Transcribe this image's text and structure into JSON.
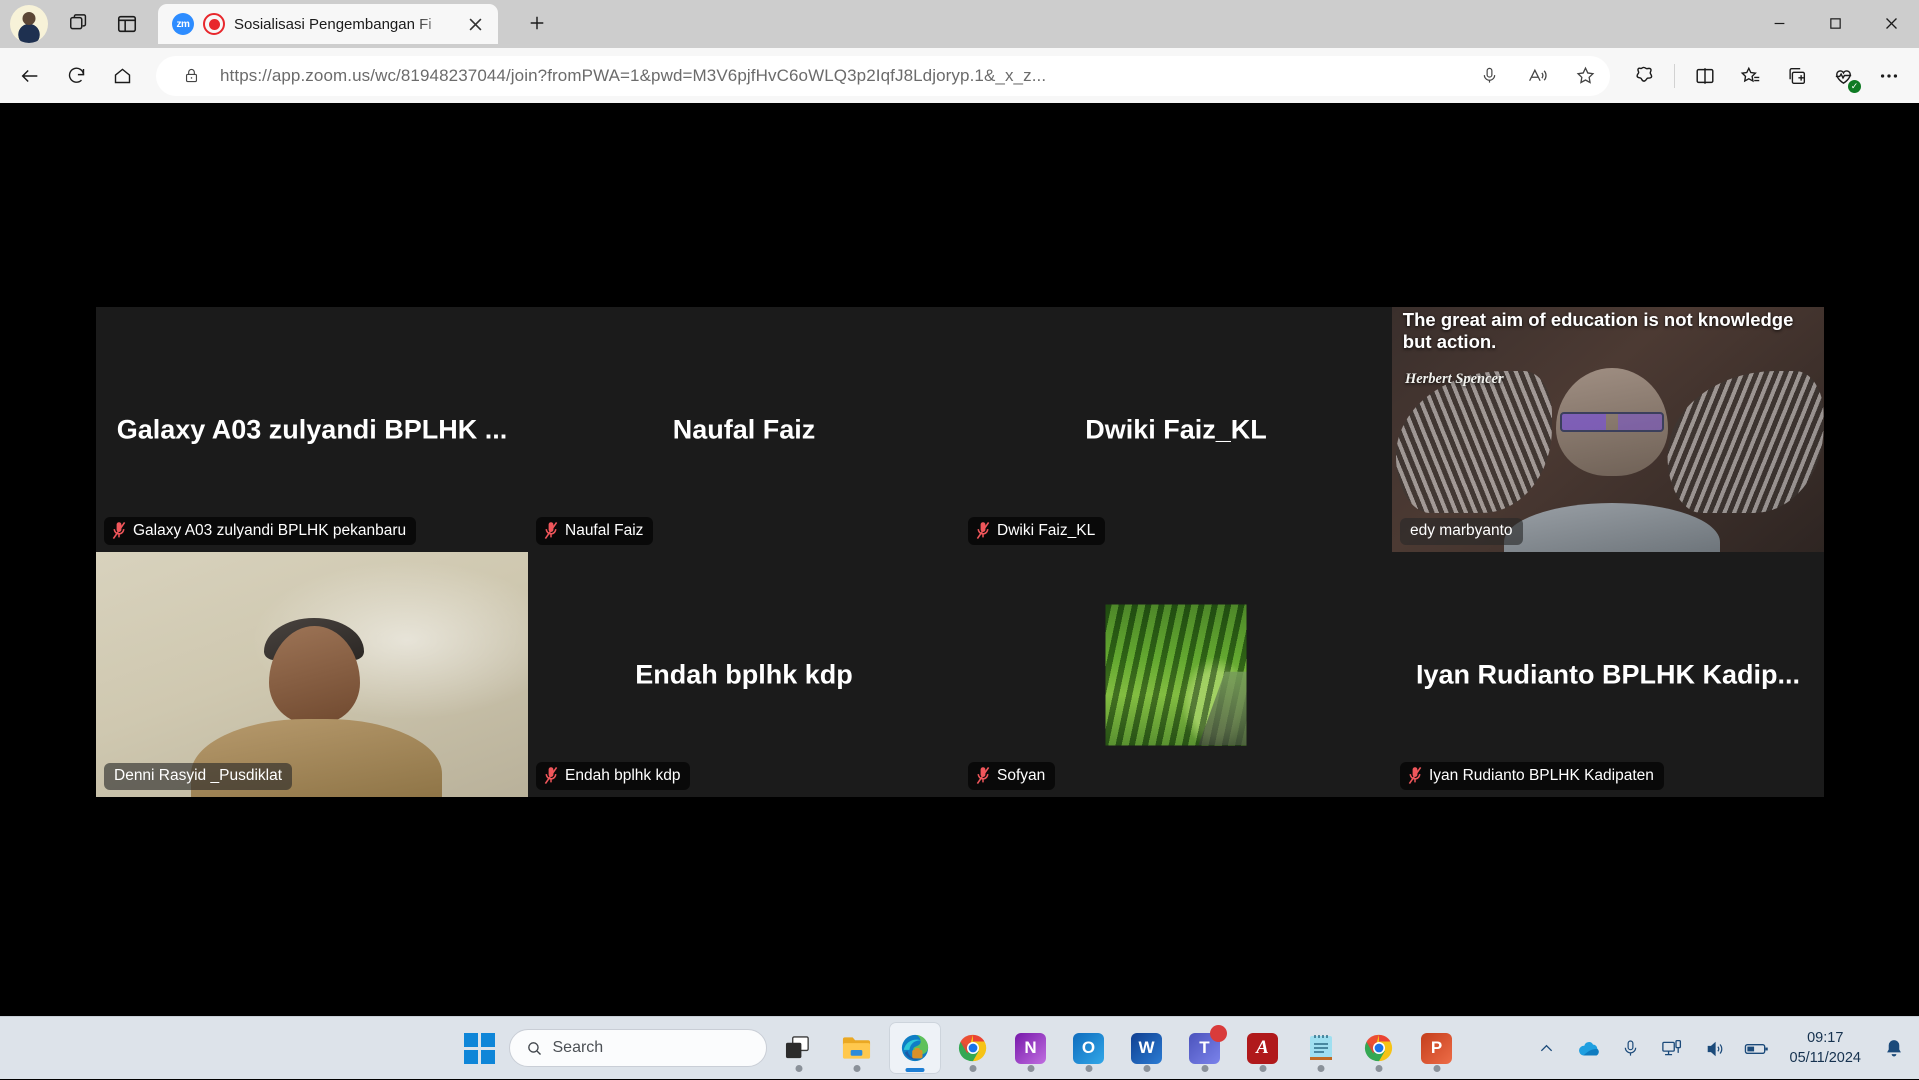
{
  "browser": {
    "tab": {
      "favicon_label": "zm",
      "recording_icon": "record-dot-icon",
      "title": "Sosialisasi Pengembangan Fi"
    },
    "new_tab_label": "+",
    "window_controls": {
      "minimize": "–",
      "maximize": "□",
      "close": "✕"
    },
    "address": {
      "url": "https://app.zoom.us/wc/81948237044/join?fromPWA=1&pwd=M3V6pjfHvC6oWLQ3p2IqfJ8Ldjoryp.1&_x_z...",
      "lock_icon": "lock-icon"
    },
    "toolbar_icons": [
      "back-icon",
      "refresh-icon",
      "home-icon",
      "microphone-icon",
      "read-aloud-icon",
      "favorite-star-icon",
      "copilot-icon",
      "split-screen-icon",
      "favorites-icon",
      "collections-icon",
      "browser-essentials-icon",
      "settings-more-icon"
    ]
  },
  "zoom": {
    "participants": [
      {
        "name": "Galaxy A03 zulyandi BPLHK ...",
        "label": "Galaxy A03 zulyandi BPLHK pekanbaru",
        "muted": true,
        "video": false,
        "active": false
      },
      {
        "name": "Naufal Faiz",
        "label": "Naufal Faiz",
        "muted": true,
        "video": false,
        "active": false
      },
      {
        "name": "Dwiki Faiz_KL",
        "label": "Dwiki Faiz_KL",
        "muted": true,
        "video": false,
        "active": false
      },
      {
        "name": "edy marbyanto",
        "label": "edy marbyanto",
        "muted": false,
        "video": true,
        "active": true
      },
      {
        "name": "Denni Rasyid _Pusdiklat",
        "label": "Denni Rasyid _Pusdiklat",
        "muted": false,
        "video": true,
        "active": false
      },
      {
        "name": "Endah bplhk kdp",
        "label": "Endah bplhk kdp",
        "muted": true,
        "video": false,
        "active": false
      },
      {
        "name": "Sofyan",
        "label": "Sofyan",
        "muted": true,
        "video": false,
        "avatar": true,
        "active": false
      },
      {
        "name": "Iyan Rudianto BPLHK Kadip...",
        "label": "Iyan Rudianto BPLHK Kadipaten",
        "muted": true,
        "video": false,
        "active": false
      }
    ],
    "edy_background": {
      "quote": "The great aim of education is not knowledge but action.",
      "author": "Herbert Spencer"
    }
  },
  "taskbar": {
    "start_label": "start-button",
    "search_placeholder": "Search",
    "apps": [
      {
        "name": "task-view",
        "glyph": "",
        "running": true
      },
      {
        "name": "file-explorer",
        "glyph": "",
        "running": true
      },
      {
        "name": "microsoft-edge",
        "glyph": "",
        "running": true,
        "active": true
      },
      {
        "name": "google-chrome",
        "glyph": "",
        "running": true
      },
      {
        "name": "onenote",
        "glyph": "N",
        "running": true
      },
      {
        "name": "outlook",
        "glyph": "O",
        "running": true
      },
      {
        "name": "word",
        "glyph": "W",
        "running": true
      },
      {
        "name": "microsoft-teams",
        "glyph": "T",
        "running": true,
        "badge": true
      },
      {
        "name": "adobe-acrobat",
        "glyph": "",
        "running": true
      },
      {
        "name": "notepad",
        "glyph": "",
        "running": true
      },
      {
        "name": "google-chrome-2",
        "glyph": "",
        "running": true
      },
      {
        "name": "powerpoint",
        "glyph": "P",
        "running": true
      }
    ],
    "tray": {
      "icons": [
        "show-hidden-icons",
        "onedrive-icon",
        "microphone-icon",
        "network-icon",
        "volume-icon",
        "battery-icon",
        "notification-bell-icon"
      ],
      "time": "09:17",
      "date": "05/11/2024"
    }
  },
  "colors": {
    "accent": "#0f86d8",
    "active_speaker": "#d6e95c",
    "muted_red": "#f0565b",
    "tab_bar": "#cdcdcd"
  }
}
